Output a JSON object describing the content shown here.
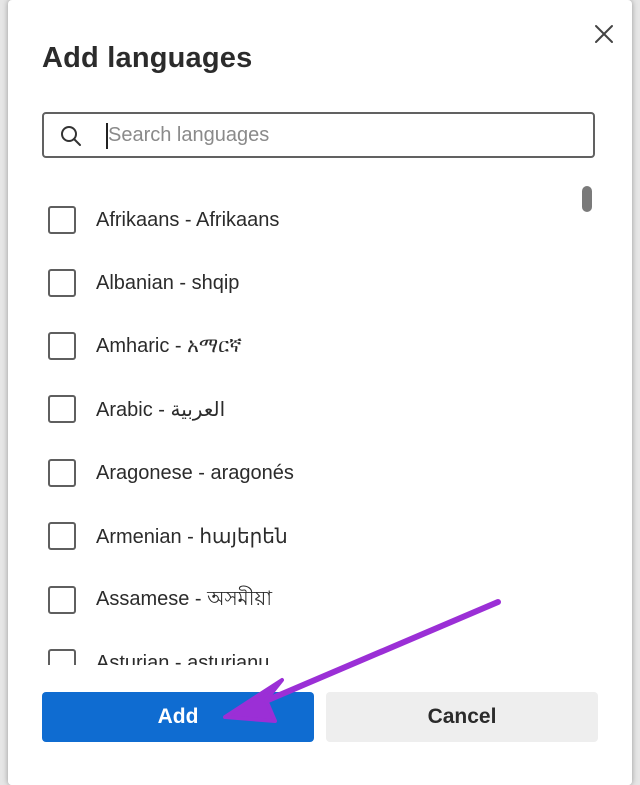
{
  "dialog": {
    "title": "Add languages",
    "search": {
      "placeholder": "Search languages",
      "value": ""
    },
    "languages": [
      {
        "label": "Afrikaans - Afrikaans",
        "checked": false
      },
      {
        "label": "Albanian - shqip",
        "checked": false
      },
      {
        "label": "Amharic - አማርኛ",
        "checked": false
      },
      {
        "label": "Arabic - العربية",
        "checked": false
      },
      {
        "label": "Aragonese - aragonés",
        "checked": false
      },
      {
        "label": "Armenian - հայերեն",
        "checked": false
      },
      {
        "label": "Assamese - অসমীয়া",
        "checked": false
      },
      {
        "label": "Asturian - asturianu",
        "checked": false
      }
    ],
    "buttons": {
      "add_label": "Add",
      "cancel_label": "Cancel"
    }
  },
  "icons": {
    "close": "close-icon",
    "search": "search-icon"
  },
  "colors": {
    "primary": "#0f6cd1",
    "annotation_arrow": "#9b2fd6"
  }
}
